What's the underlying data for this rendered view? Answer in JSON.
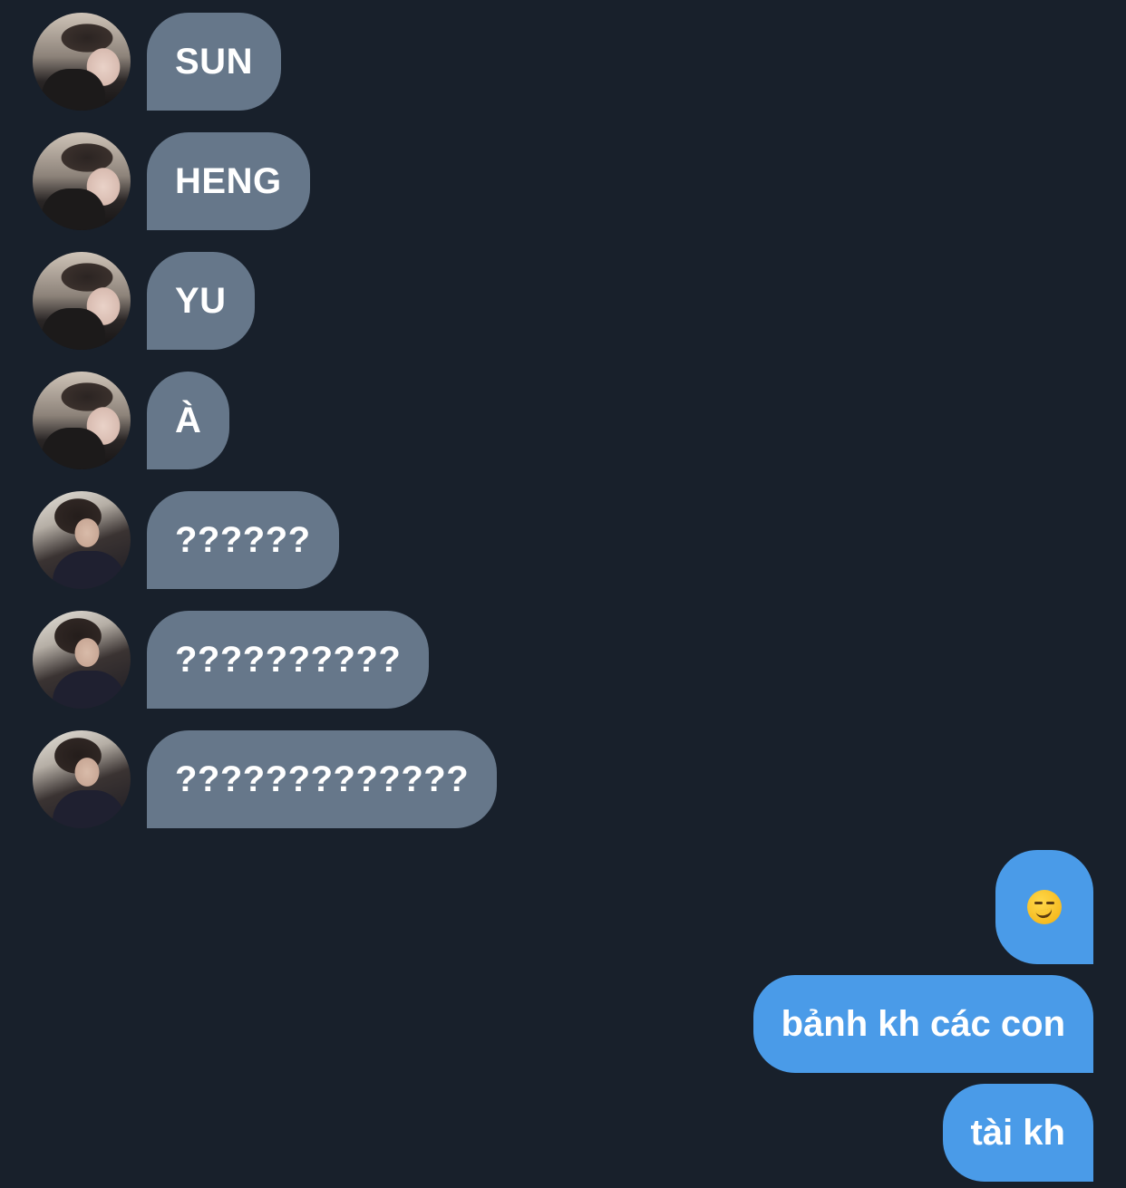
{
  "incoming_messages": [
    {
      "sender": "a",
      "text": "SUN"
    },
    {
      "sender": "a",
      "text": "HENG"
    },
    {
      "sender": "a",
      "text": "YU"
    },
    {
      "sender": "a",
      "text": "À"
    },
    {
      "sender": "b",
      "text": "??????"
    },
    {
      "sender": "b",
      "text": "??????????"
    },
    {
      "sender": "b",
      "text": "?????????????"
    }
  ],
  "outgoing_messages": [
    {
      "type": "emoji",
      "emoji": "smirking-face"
    },
    {
      "type": "text",
      "text": "bảnh kh các con"
    },
    {
      "type": "text",
      "text": "tài kh"
    }
  ],
  "colors": {
    "background": "#18202b",
    "incoming_bubble": "#66778a",
    "outgoing_bubble": "#4a9be8",
    "text": "#ffffff"
  }
}
